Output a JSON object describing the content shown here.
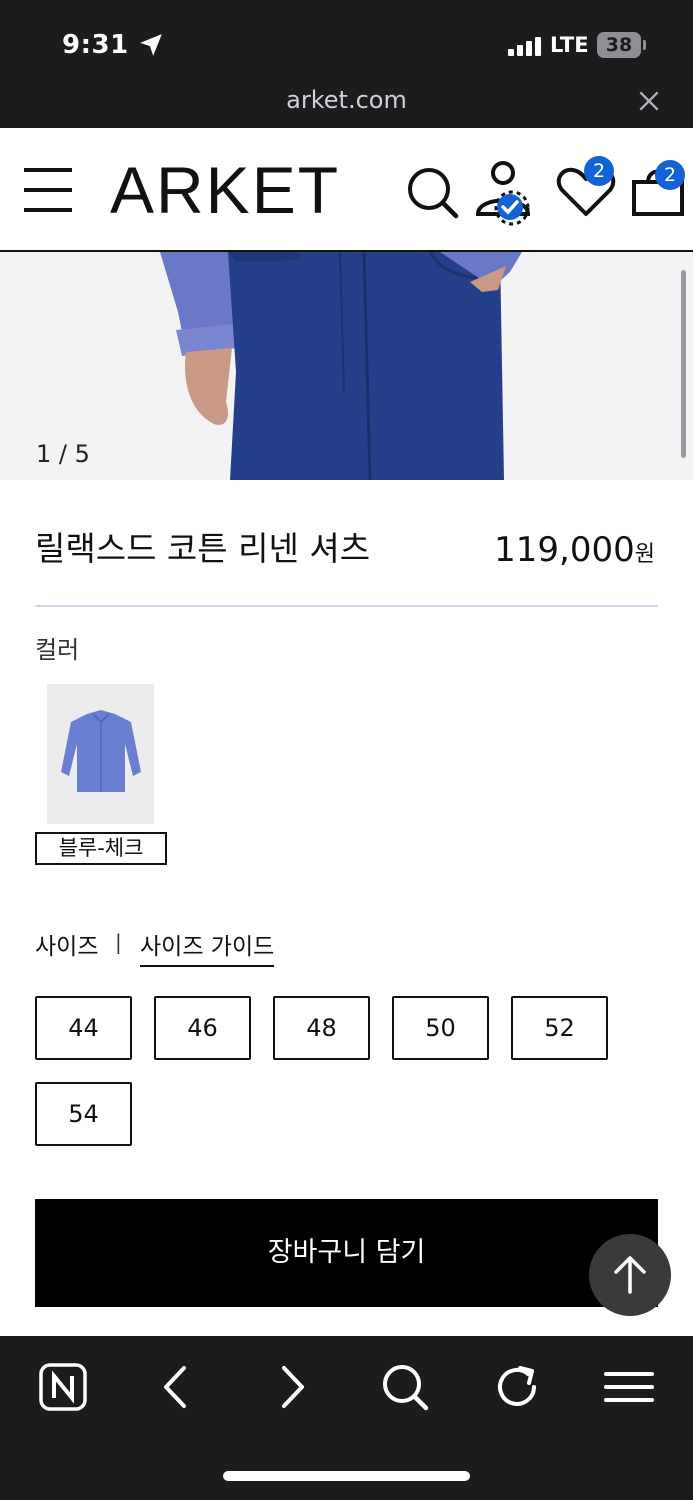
{
  "status_bar": {
    "time": "9:31",
    "network": "LTE",
    "battery": "38"
  },
  "browser": {
    "url": "arket.com"
  },
  "header": {
    "logo": "ARKET",
    "wishlist_count": "2",
    "cart_count": "2"
  },
  "gallery": {
    "counter": "1 / 5"
  },
  "product": {
    "name": "릴랙스드 코튼 리넨 셔츠",
    "price": "119,000",
    "currency": "원"
  },
  "color": {
    "label": "컬러",
    "selected_name": "블루-체크"
  },
  "size": {
    "label": "사이즈",
    "separator": "|",
    "guide_label": "사이즈 가이드",
    "options": [
      "44",
      "46",
      "48",
      "50",
      "52",
      "54"
    ]
  },
  "cart": {
    "add_label": "장바구니 담기"
  },
  "icons": {
    "menu": "hamburger-icon",
    "search": "search-icon",
    "account": "account-verified-icon",
    "wishlist": "heart-icon",
    "cart": "bag-icon",
    "scroll_top": "arrow-up-icon",
    "naver": "naver-n-icon",
    "back": "chevron-left-icon",
    "forward": "chevron-right-icon",
    "reload": "reload-icon",
    "tabs": "menu-icon"
  },
  "colors": {
    "badge": "#1463d6",
    "chrome": "#1c1c1e",
    "button": "#000000"
  }
}
